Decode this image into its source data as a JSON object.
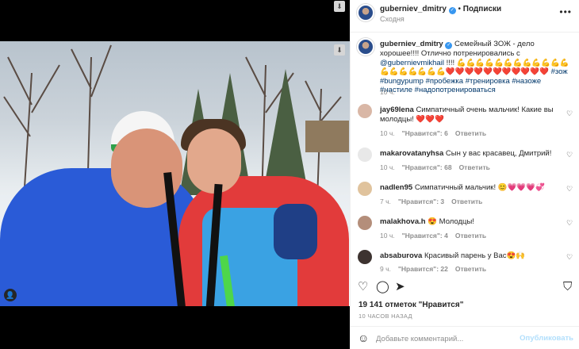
{
  "header": {
    "username": "gubernievdmitry",
    "username_display": "guberniev_dmitry",
    "follow_label": "Подписки",
    "location": "Сходня"
  },
  "caption": {
    "username": "guberniev_dmitry",
    "text_before": "Семейный ЗОЖ - дело хорошее!!!! Отлично потренировались с ",
    "mention": "@gubernievmikhail",
    "text_after": " !!!! 💪💪💪💪💪💪💪💪💪💪💪💪💪💪💪💪💪💪💪❤️❤️❤️❤️❤️❤️❤️❤️❤️❤️❤️ ",
    "hashtags": "#зож #bungypump #пробежка #тренировка #назоже #настиле #надопотренироваться",
    "time": "10 ч."
  },
  "comments": [
    {
      "username": "jay69lena",
      "text": "Симпатичный очень мальчик! Какие вы молодцы! ❤️❤️❤️",
      "time": "10 ч.",
      "likes": "\"Нравится\": 6",
      "reply": "Ответить"
    },
    {
      "username": "makarovatanyhsa",
      "text": "Сын у вас красавец, Дмитрий!",
      "time": "10 ч.",
      "likes": "\"Нравится\": 68",
      "reply": "Ответить"
    },
    {
      "username": "nadlen95",
      "text": "Симпатичный мальчик! 😊💗💗💗💞",
      "time": "7 ч.",
      "likes": "\"Нравится\": 3",
      "reply": "Ответить"
    },
    {
      "username": "malakhova.h",
      "text": "😍 Молодцы!",
      "time": "10 ч.",
      "likes": "\"Нравится\": 4",
      "reply": "Ответить"
    },
    {
      "username": "absaburova",
      "text": "Красивый парень у Вас😍🙌",
      "time": "9 ч.",
      "likes": "\"Нравится\": 22",
      "reply": "Ответить"
    }
  ],
  "footer": {
    "likes_text": "19 141 отметок \"Нравится\"",
    "time_ago": "10 ЧАСОВ НАЗАД",
    "comment_placeholder": "Добавьте комментарий...",
    "post_label": "Опубликовать"
  },
  "icons": {
    "like": "heart-icon",
    "comment": "comment-icon",
    "share": "share-icon",
    "save": "bookmark-icon",
    "more": "more-icon",
    "emoji": "emoji-icon",
    "download": "download-icon",
    "user_tags": "user-tag-icon"
  },
  "colors": {
    "link": "#00376b",
    "verified": "#3897f0",
    "post_disabled": "#b2dffc"
  }
}
